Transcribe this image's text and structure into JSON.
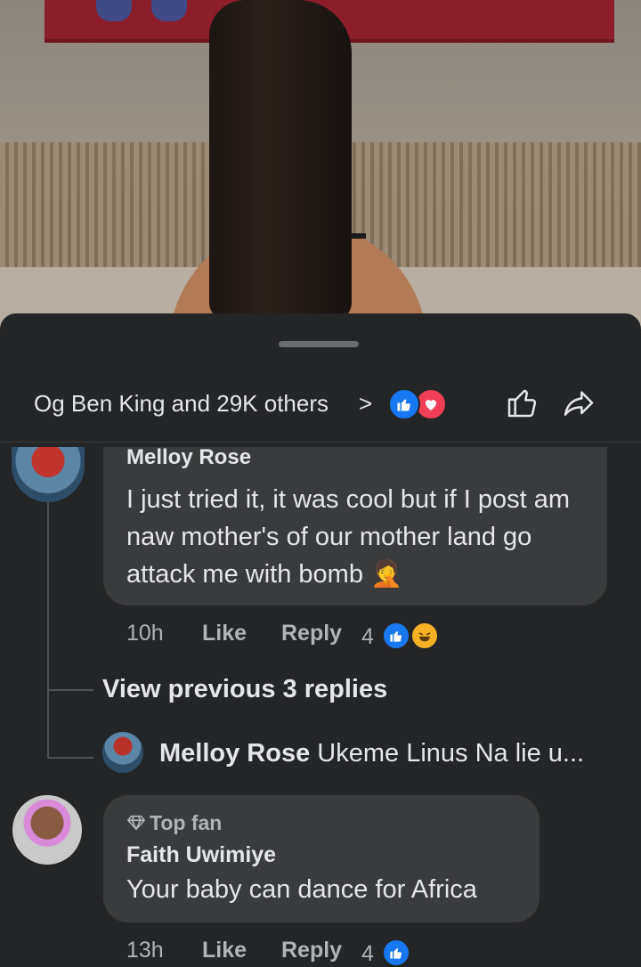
{
  "reactions_bar": {
    "summary": "Og Ben King and 29K others",
    "chevron": ">",
    "reaction_icons": [
      "like-icon",
      "love-icon"
    ],
    "action_icons": [
      "thumbs-up-icon",
      "share-icon"
    ]
  },
  "comment1": {
    "author": "Melloy Rose",
    "text": "I just tried it, it was cool but if I post am naw mother's of our mother land go attack me with bomb 🤦",
    "time": "10h",
    "like_label": "Like",
    "reply_label": "Reply",
    "reaction_count": "4",
    "reactions": [
      "like-icon",
      "haha-icon"
    ]
  },
  "view_previous": "View previous 3 replies",
  "reply_preview": {
    "author": "Melloy Rose",
    "text": "Ukeme Linus Na lie u..."
  },
  "comment2": {
    "badge": "Top fan",
    "author": "Faith Uwimiye",
    "text": "Your baby can dance for Africa",
    "time": "13h",
    "like_label": "Like",
    "reply_label": "Reply",
    "reaction_count": "4",
    "reactions": [
      "like-icon"
    ]
  },
  "colors": {
    "sheet_bg": "#242526",
    "bubble_bg": "#3a3b3c",
    "like_blue": "#1877f2",
    "love_red": "#f33e58",
    "secondary_text": "#b0b3b8"
  }
}
